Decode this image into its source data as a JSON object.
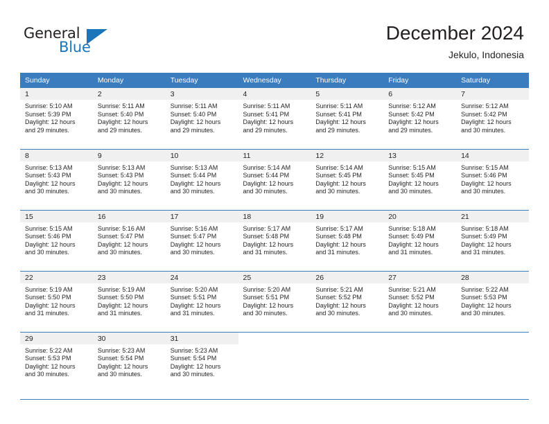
{
  "brand": {
    "name_top": "General",
    "name_bottom": "Blue",
    "triangle_icon": "triangle-icon",
    "color_dark": "#231f20",
    "color_blue": "#1b75bb"
  },
  "header": {
    "title": "December 2024",
    "subtitle": "Jekulo, Indonesia"
  },
  "theme": {
    "header_bg": "#3a7cbe",
    "header_text": "#ffffff",
    "daynum_bg": "#f0f0f0",
    "grid_line": "#3a7cbe",
    "body_text": "#231f20"
  },
  "weekdays": [
    "Sunday",
    "Monday",
    "Tuesday",
    "Wednesday",
    "Thursday",
    "Friday",
    "Saturday"
  ],
  "weeks": [
    [
      {
        "day": "1",
        "sunrise": "Sunrise: 5:10 AM",
        "sunset": "Sunset: 5:39 PM",
        "daylight1": "Daylight: 12 hours",
        "daylight2": "and 29 minutes."
      },
      {
        "day": "2",
        "sunrise": "Sunrise: 5:11 AM",
        "sunset": "Sunset: 5:40 PM",
        "daylight1": "Daylight: 12 hours",
        "daylight2": "and 29 minutes."
      },
      {
        "day": "3",
        "sunrise": "Sunrise: 5:11 AM",
        "sunset": "Sunset: 5:40 PM",
        "daylight1": "Daylight: 12 hours",
        "daylight2": "and 29 minutes."
      },
      {
        "day": "4",
        "sunrise": "Sunrise: 5:11 AM",
        "sunset": "Sunset: 5:41 PM",
        "daylight1": "Daylight: 12 hours",
        "daylight2": "and 29 minutes."
      },
      {
        "day": "5",
        "sunrise": "Sunrise: 5:11 AM",
        "sunset": "Sunset: 5:41 PM",
        "daylight1": "Daylight: 12 hours",
        "daylight2": "and 29 minutes."
      },
      {
        "day": "6",
        "sunrise": "Sunrise: 5:12 AM",
        "sunset": "Sunset: 5:42 PM",
        "daylight1": "Daylight: 12 hours",
        "daylight2": "and 29 minutes."
      },
      {
        "day": "7",
        "sunrise": "Sunrise: 5:12 AM",
        "sunset": "Sunset: 5:42 PM",
        "daylight1": "Daylight: 12 hours",
        "daylight2": "and 30 minutes."
      }
    ],
    [
      {
        "day": "8",
        "sunrise": "Sunrise: 5:13 AM",
        "sunset": "Sunset: 5:43 PM",
        "daylight1": "Daylight: 12 hours",
        "daylight2": "and 30 minutes."
      },
      {
        "day": "9",
        "sunrise": "Sunrise: 5:13 AM",
        "sunset": "Sunset: 5:43 PM",
        "daylight1": "Daylight: 12 hours",
        "daylight2": "and 30 minutes."
      },
      {
        "day": "10",
        "sunrise": "Sunrise: 5:13 AM",
        "sunset": "Sunset: 5:44 PM",
        "daylight1": "Daylight: 12 hours",
        "daylight2": "and 30 minutes."
      },
      {
        "day": "11",
        "sunrise": "Sunrise: 5:14 AM",
        "sunset": "Sunset: 5:44 PM",
        "daylight1": "Daylight: 12 hours",
        "daylight2": "and 30 minutes."
      },
      {
        "day": "12",
        "sunrise": "Sunrise: 5:14 AM",
        "sunset": "Sunset: 5:45 PM",
        "daylight1": "Daylight: 12 hours",
        "daylight2": "and 30 minutes."
      },
      {
        "day": "13",
        "sunrise": "Sunrise: 5:15 AM",
        "sunset": "Sunset: 5:45 PM",
        "daylight1": "Daylight: 12 hours",
        "daylight2": "and 30 minutes."
      },
      {
        "day": "14",
        "sunrise": "Sunrise: 5:15 AM",
        "sunset": "Sunset: 5:46 PM",
        "daylight1": "Daylight: 12 hours",
        "daylight2": "and 30 minutes."
      }
    ],
    [
      {
        "day": "15",
        "sunrise": "Sunrise: 5:15 AM",
        "sunset": "Sunset: 5:46 PM",
        "daylight1": "Daylight: 12 hours",
        "daylight2": "and 30 minutes."
      },
      {
        "day": "16",
        "sunrise": "Sunrise: 5:16 AM",
        "sunset": "Sunset: 5:47 PM",
        "daylight1": "Daylight: 12 hours",
        "daylight2": "and 30 minutes."
      },
      {
        "day": "17",
        "sunrise": "Sunrise: 5:16 AM",
        "sunset": "Sunset: 5:47 PM",
        "daylight1": "Daylight: 12 hours",
        "daylight2": "and 30 minutes."
      },
      {
        "day": "18",
        "sunrise": "Sunrise: 5:17 AM",
        "sunset": "Sunset: 5:48 PM",
        "daylight1": "Daylight: 12 hours",
        "daylight2": "and 31 minutes."
      },
      {
        "day": "19",
        "sunrise": "Sunrise: 5:17 AM",
        "sunset": "Sunset: 5:48 PM",
        "daylight1": "Daylight: 12 hours",
        "daylight2": "and 31 minutes."
      },
      {
        "day": "20",
        "sunrise": "Sunrise: 5:18 AM",
        "sunset": "Sunset: 5:49 PM",
        "daylight1": "Daylight: 12 hours",
        "daylight2": "and 31 minutes."
      },
      {
        "day": "21",
        "sunrise": "Sunrise: 5:18 AM",
        "sunset": "Sunset: 5:49 PM",
        "daylight1": "Daylight: 12 hours",
        "daylight2": "and 31 minutes."
      }
    ],
    [
      {
        "day": "22",
        "sunrise": "Sunrise: 5:19 AM",
        "sunset": "Sunset: 5:50 PM",
        "daylight1": "Daylight: 12 hours",
        "daylight2": "and 31 minutes."
      },
      {
        "day": "23",
        "sunrise": "Sunrise: 5:19 AM",
        "sunset": "Sunset: 5:50 PM",
        "daylight1": "Daylight: 12 hours",
        "daylight2": "and 31 minutes."
      },
      {
        "day": "24",
        "sunrise": "Sunrise: 5:20 AM",
        "sunset": "Sunset: 5:51 PM",
        "daylight1": "Daylight: 12 hours",
        "daylight2": "and 31 minutes."
      },
      {
        "day": "25",
        "sunrise": "Sunrise: 5:20 AM",
        "sunset": "Sunset: 5:51 PM",
        "daylight1": "Daylight: 12 hours",
        "daylight2": "and 30 minutes."
      },
      {
        "day": "26",
        "sunrise": "Sunrise: 5:21 AM",
        "sunset": "Sunset: 5:52 PM",
        "daylight1": "Daylight: 12 hours",
        "daylight2": "and 30 minutes."
      },
      {
        "day": "27",
        "sunrise": "Sunrise: 5:21 AM",
        "sunset": "Sunset: 5:52 PM",
        "daylight1": "Daylight: 12 hours",
        "daylight2": "and 30 minutes."
      },
      {
        "day": "28",
        "sunrise": "Sunrise: 5:22 AM",
        "sunset": "Sunset: 5:53 PM",
        "daylight1": "Daylight: 12 hours",
        "daylight2": "and 30 minutes."
      }
    ],
    [
      {
        "day": "29",
        "sunrise": "Sunrise: 5:22 AM",
        "sunset": "Sunset: 5:53 PM",
        "daylight1": "Daylight: 12 hours",
        "daylight2": "and 30 minutes."
      },
      {
        "day": "30",
        "sunrise": "Sunrise: 5:23 AM",
        "sunset": "Sunset: 5:54 PM",
        "daylight1": "Daylight: 12 hours",
        "daylight2": "and 30 minutes."
      },
      {
        "day": "31",
        "sunrise": "Sunrise: 5:23 AM",
        "sunset": "Sunset: 5:54 PM",
        "daylight1": "Daylight: 12 hours",
        "daylight2": "and 30 minutes."
      },
      {
        "day": "",
        "sunrise": "",
        "sunset": "",
        "daylight1": "",
        "daylight2": ""
      },
      {
        "day": "",
        "sunrise": "",
        "sunset": "",
        "daylight1": "",
        "daylight2": ""
      },
      {
        "day": "",
        "sunrise": "",
        "sunset": "",
        "daylight1": "",
        "daylight2": ""
      },
      {
        "day": "",
        "sunrise": "",
        "sunset": "",
        "daylight1": "",
        "daylight2": ""
      }
    ]
  ]
}
